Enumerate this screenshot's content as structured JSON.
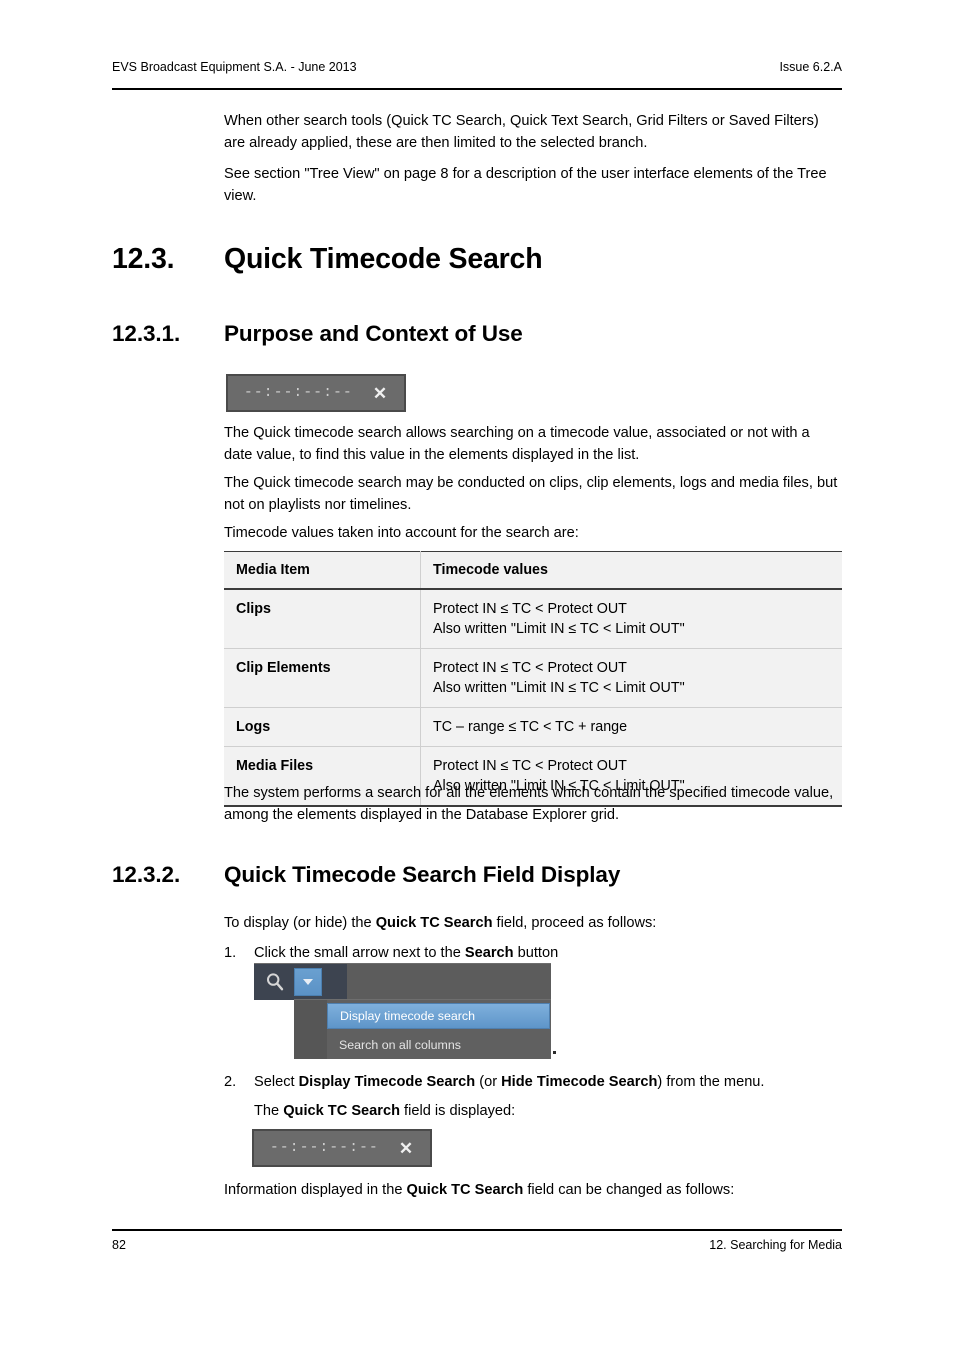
{
  "header": {
    "left": "EVS Broadcast Equipment S.A.  - June 2013",
    "right": "Issue 6.2.A"
  },
  "footer": {
    "page_number": "82",
    "chapter": "12. Searching for Media"
  },
  "intro": {
    "paragraph_1": "When other search tools (Quick TC Search, Quick Text Search, Grid Filters or Saved Filters) are already applied, these are then limited to the selected branch.",
    "paragraph_2": "See section \"Tree View\" on page 8 for a description of the user interface elements of the Tree view."
  },
  "section_12_3": {
    "number": "12.3.",
    "title": "Quick Timecode Search"
  },
  "section_12_3_1": {
    "number": "12.3.1.",
    "title": "Purpose and Context of Use",
    "paragraph_1": "The Quick timecode search allows searching on a timecode value, associated or not with a date value, to find this value in the elements displayed in the list.",
    "paragraph_2": "The Quick timecode search may be conducted on clips, clip elements, logs and media files, but not on playlists nor timelines.",
    "paragraph_3": "Timecode values taken into account for the search are:",
    "paragraph_4": "The system performs a search for all the elements which contain the specified timecode value, among the elements displayed in the Database Explorer grid."
  },
  "tc_widget_1": {
    "value": "--:--:--:--",
    "clear_icon": "close-x",
    "clear_label": "✕",
    "bg_color": "#6b6b6b",
    "border_color": "#4a4a4a",
    "text_color": "#cfcfcf"
  },
  "tc_widget_2": {
    "value": "--:--:--:--",
    "clear_icon": "close-x",
    "clear_label": "✕"
  },
  "table": {
    "headers": [
      "Media Item",
      "Timecode values"
    ],
    "rows": [
      {
        "item": "Clips",
        "lines": [
          "Protect IN ≤ TC < Protect OUT",
          "Also written \"Limit IN ≤ TC < Limit OUT\""
        ]
      },
      {
        "item": "Clip Elements",
        "lines": [
          "Protect IN ≤ TC < Protect OUT",
          "Also written \"Limit IN ≤ TC < Limit OUT\""
        ]
      },
      {
        "item": "Logs",
        "lines": [
          "TC – range ≤ TC < TC + range"
        ]
      },
      {
        "item": "Media Files",
        "lines": [
          "Protect IN ≤ TC < Protect OUT",
          "Also written \"Limit IN ≤ TC < Limit OUT\""
        ]
      }
    ]
  },
  "section_12_3_2": {
    "number": "12.3.2.",
    "title": "Quick Timecode Search Field Display",
    "lead_in_a": "To display (or hide) the ",
    "lead_in_bold": "Quick TC Search",
    "lead_in_b": " field, proceed as follows:",
    "step_1": {
      "marker": "1.",
      "text_a": "Click the small arrow next to the ",
      "bold": "Search",
      "text_b": " button"
    },
    "step_2": {
      "marker": "2.",
      "text_a": "Select ",
      "bold_1": "Display Timecode Search",
      "text_b": " (or ",
      "bold_2": "Hide Timecode Search",
      "text_c": ") from the menu."
    },
    "displayed_a": "The ",
    "displayed_bold": "Quick TC Search",
    "displayed_b": " field is displayed:",
    "closing_a": "Information displayed in the ",
    "closing_bold": "Quick TC Search",
    "closing_b": " field can be changed as follows:"
  },
  "menu_screenshot": {
    "search_icon": "magnifier-icon",
    "dropdown_arrow_icon": "chevron-down-icon",
    "items": [
      {
        "label": "Display timecode search",
        "selected": true
      },
      {
        "label": "Search on all columns",
        "selected": false
      }
    ],
    "accent_color": "#6aa0d0",
    "panel_color": "#606060",
    "toolbar_color": "#5c5c5c"
  }
}
